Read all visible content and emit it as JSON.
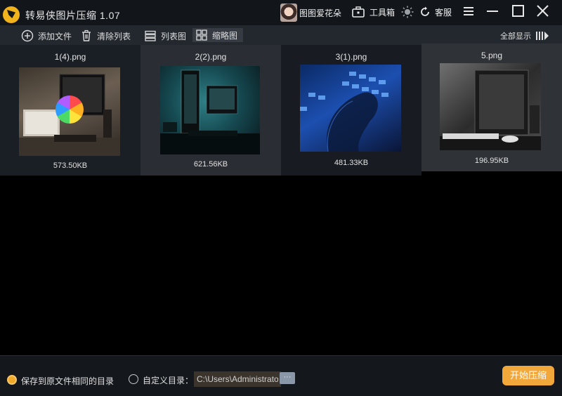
{
  "app": {
    "title": "转易侠图片压缩 1.07",
    "username": "图图爱花朵",
    "toolbox_label": "工具箱",
    "service_label": "客服"
  },
  "toolbar": {
    "add_files": "添加文件",
    "clear_list": "清除列表",
    "list_view": "列表图",
    "thumb_view": "缩略图",
    "show_all": "全部显示"
  },
  "files": [
    {
      "name": "1(4).png",
      "size": "573.50KB"
    },
    {
      "name": "2(2).png",
      "size": "621.56KB"
    },
    {
      "name": "3(1).png",
      "size": "481.33KB"
    },
    {
      "name": "5.png",
      "size": "196.95KB"
    }
  ],
  "footer": {
    "save_same_dir": "保存到原文件相同的目录",
    "custom_dir": "自定义目录：",
    "custom_path": "C:\\Users\\Administrato",
    "browse": "···",
    "start": "开始压缩"
  },
  "colors": {
    "accent": "#f2a73b",
    "titlebar": "#12161b",
    "toolbar": "#23282e"
  }
}
